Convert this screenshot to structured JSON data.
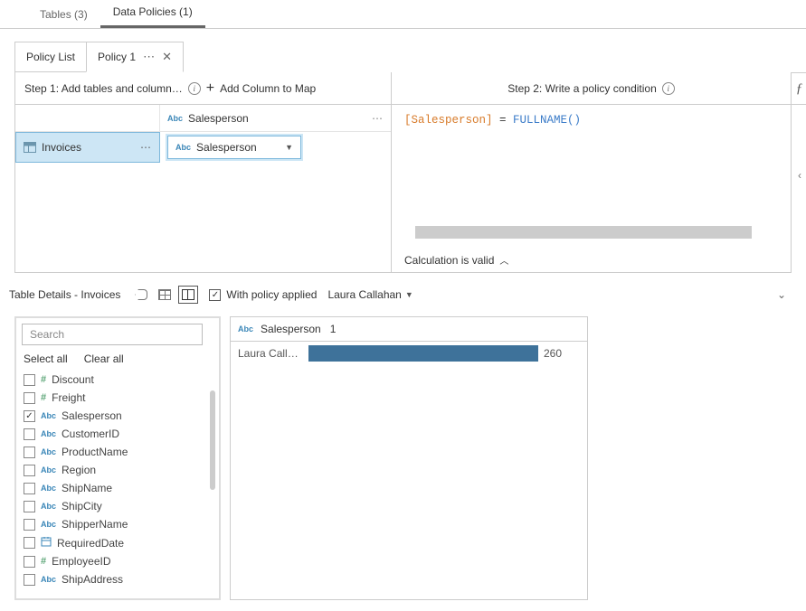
{
  "top_tabs": {
    "tables": "Tables (3)",
    "policies": "Data Policies (1)"
  },
  "policy_tabs": {
    "list": "Policy List",
    "current": "Policy 1"
  },
  "step1": {
    "title": "Step 1: Add tables and column…",
    "add_col": "Add Column to Map",
    "header_col": "Salesperson",
    "table_name": "Invoices",
    "mapped_col": "Salesperson"
  },
  "step2": {
    "title": "Step 2: Write a policy condition",
    "code_field": "[Salesperson]",
    "code_eq": " = ",
    "code_fn": "FULLNAME()",
    "valid": "Calculation is valid"
  },
  "details": {
    "title": "Table Details - Invoices",
    "with_policy": "With policy applied",
    "user": "Laura Callahan",
    "search_ph": "Search",
    "select_all": "Select all",
    "clear_all": "Clear all"
  },
  "fields": [
    {
      "type": "hash",
      "name": "Discount",
      "checked": false
    },
    {
      "type": "hash",
      "name": "Freight",
      "checked": false
    },
    {
      "type": "abc",
      "name": "Salesperson",
      "checked": true
    },
    {
      "type": "abc",
      "name": "CustomerID",
      "checked": false
    },
    {
      "type": "abc",
      "name": "ProductName",
      "checked": false
    },
    {
      "type": "abc",
      "name": "Region",
      "checked": false
    },
    {
      "type": "abc",
      "name": "ShipName",
      "checked": false
    },
    {
      "type": "abc",
      "name": "ShipCity",
      "checked": false
    },
    {
      "type": "abc",
      "name": "ShipperName",
      "checked": false
    },
    {
      "type": "date",
      "name": "RequiredDate",
      "checked": false
    },
    {
      "type": "hash",
      "name": "EmployeeID",
      "checked": false
    },
    {
      "type": "abc",
      "name": "ShipAddress",
      "checked": false
    }
  ],
  "chart_data": {
    "type": "bar",
    "title": "Salesperson",
    "distinct_count": "1",
    "categories": [
      "Laura Calla…"
    ],
    "values": [
      260
    ]
  }
}
